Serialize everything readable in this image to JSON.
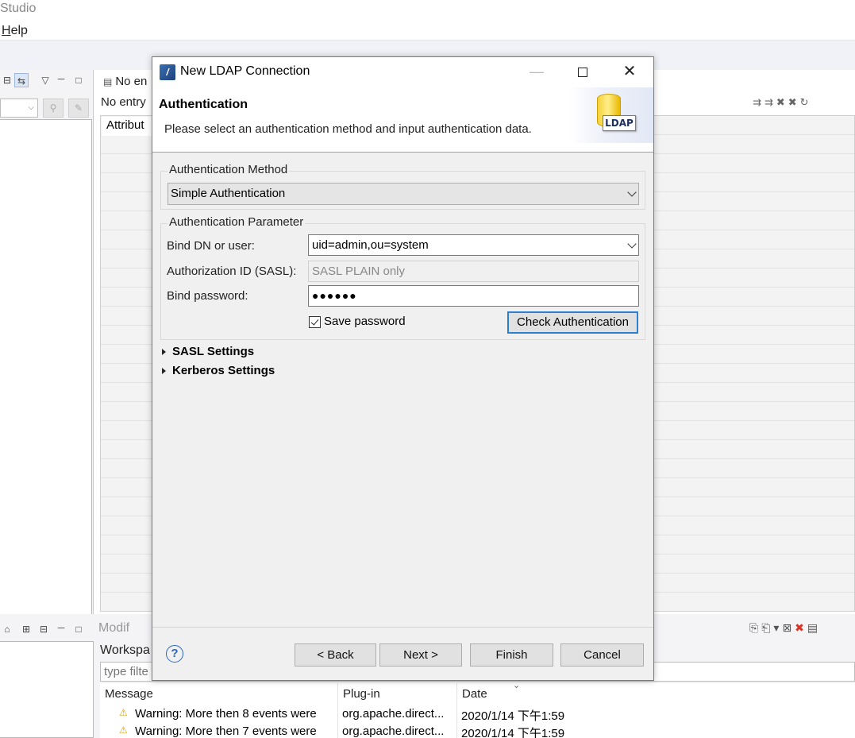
{
  "app": {
    "title": "Studio",
    "menu_help": "Help",
    "menu_help_rest": "elp",
    "menu_help_mnemonic": "H"
  },
  "editor": {
    "tab_label": "No en",
    "no_entry_text": "No entry",
    "table_header": "Attribut"
  },
  "bottom": {
    "modifications_tab": "Modif",
    "workspace_label": "Workspa",
    "filter_placeholder": "type filte",
    "columns": [
      "Message",
      "Plug-in",
      "Date"
    ],
    "rows": [
      {
        "message": "Warning: More then 8 events were",
        "plugin": "org.apache.direct...",
        "date": "2020/1/14 下午1:59"
      },
      {
        "message": "Warning: More then 7 events were",
        "plugin": "org.apache.direct...",
        "date": "2020/1/14 下午1:59"
      }
    ]
  },
  "dialog": {
    "title": "New LDAP Connection",
    "banner_title": "Authentication",
    "banner_description": "Please select an authentication method and input authentication data.",
    "banner_image_label": "LDAP",
    "method_group": {
      "legend": "Authentication Method",
      "selected": "Simple Authentication"
    },
    "param_group": {
      "legend": "Authentication Parameter",
      "bind_dn_label": "Bind DN or user:",
      "bind_dn_value": "uid=admin,ou=system",
      "authz_label": "Authorization ID (SASL):",
      "authz_placeholder": "SASL PLAIN only",
      "password_label": "Bind password:",
      "password_value": "●●●●●●",
      "save_password_label": "Save password",
      "save_password_checked": true,
      "check_button": "Check Authentication"
    },
    "sections": [
      "SASL Settings",
      "Kerberos Settings"
    ],
    "buttons": {
      "back": "< Back",
      "next": "Next >",
      "finish": "Finish",
      "cancel": "Cancel",
      "help": "?"
    }
  },
  "colors": {
    "accent": "#2f7fd0",
    "dialog_bg": "#f0f0f0",
    "warning": "#d9a200"
  }
}
